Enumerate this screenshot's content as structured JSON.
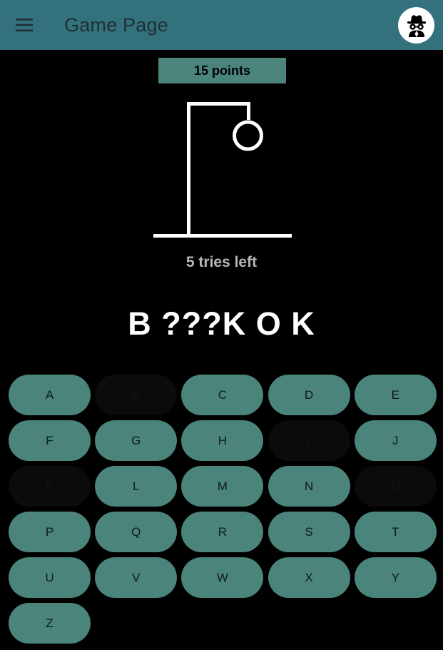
{
  "appbar": {
    "title": "Game Page",
    "menu_icon": "hamburger-menu-icon",
    "avatar_icon": "spy-incognito-icon",
    "color": "#33727d"
  },
  "game": {
    "score_label": "15 points",
    "tries_label": "5 tries left",
    "word_display": "B ???K O K"
  },
  "keyboard": {
    "key_color": "#4a847b",
    "used_key_color": "#0b0b0b",
    "keys": [
      {
        "letter": "A",
        "used": false
      },
      {
        "letter": "B",
        "used": true
      },
      {
        "letter": "C",
        "used": false
      },
      {
        "letter": "D",
        "used": false
      },
      {
        "letter": "E",
        "used": false
      },
      {
        "letter": "F",
        "used": false
      },
      {
        "letter": "G",
        "used": false
      },
      {
        "letter": "H",
        "used": false
      },
      {
        "letter": "I",
        "used": true
      },
      {
        "letter": "J",
        "used": false
      },
      {
        "letter": "K",
        "used": true
      },
      {
        "letter": "L",
        "used": false
      },
      {
        "letter": "M",
        "used": false
      },
      {
        "letter": "N",
        "used": false
      },
      {
        "letter": "O",
        "used": true
      },
      {
        "letter": "P",
        "used": false
      },
      {
        "letter": "Q",
        "used": false
      },
      {
        "letter": "R",
        "used": false
      },
      {
        "letter": "S",
        "used": false
      },
      {
        "letter": "T",
        "used": false
      },
      {
        "letter": "U",
        "used": false
      },
      {
        "letter": "V",
        "used": false
      },
      {
        "letter": "W",
        "used": false
      },
      {
        "letter": "X",
        "used": false
      },
      {
        "letter": "Y",
        "used": false
      },
      {
        "letter": "Z",
        "used": false
      }
    ]
  }
}
